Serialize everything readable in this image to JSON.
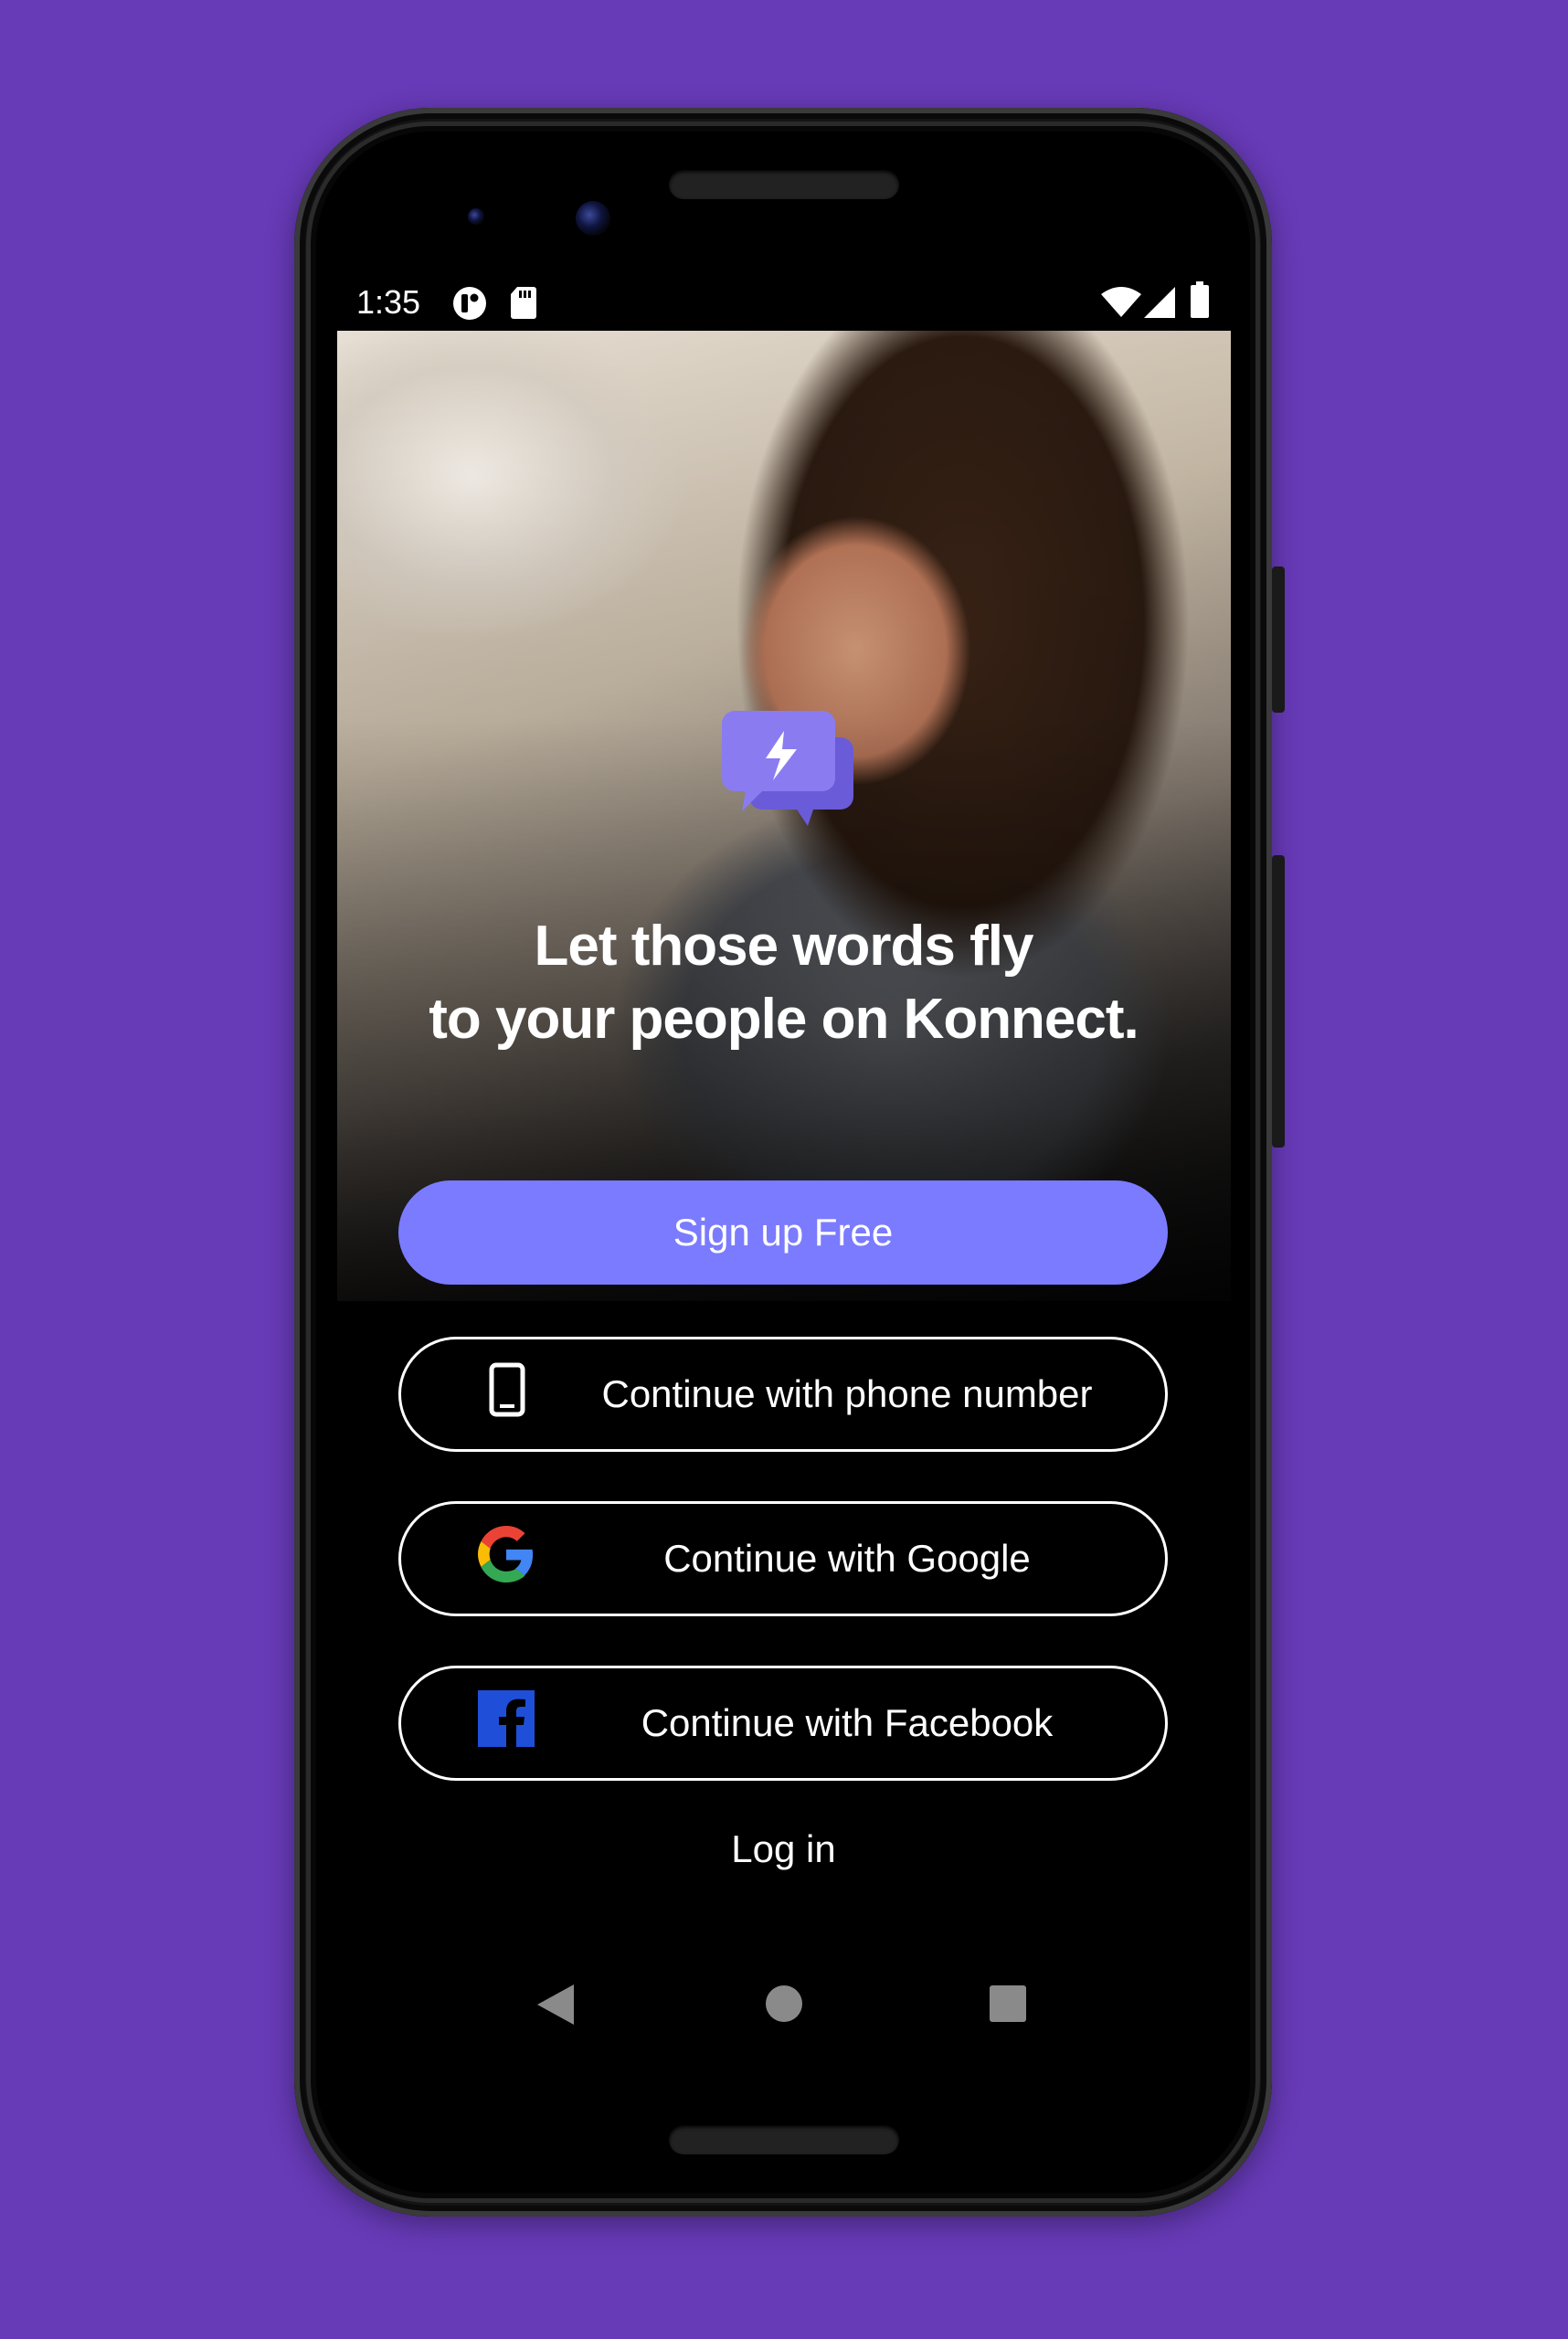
{
  "theme": {
    "background": "#673ab7",
    "accent": "#7b7bff",
    "logo_front": "#8a7cf0",
    "logo_back": "#6a5bd8",
    "facebook_blue": "#1f4fd8"
  },
  "status_bar": {
    "time": "1:35",
    "icons": [
      "app-notification-icon",
      "sd-card-icon",
      "wifi-icon",
      "cellular-signal-icon",
      "battery-icon"
    ]
  },
  "hero": {
    "logo_icon": "lightning-chat-bubble-icon",
    "headline_line1": "Let those words fly",
    "headline_line2": "to your people on Konnect."
  },
  "actions": {
    "signup_label": "Sign up Free",
    "phone_label": "Continue with phone number",
    "phone_icon": "smartphone-icon",
    "google_label": "Continue with Google",
    "google_icon": "google-g-icon",
    "facebook_label": "Continue with Facebook",
    "facebook_icon": "facebook-icon",
    "login_label": "Log in"
  },
  "nav_bar": {
    "items": [
      "back-triangle-icon",
      "home-circle-icon",
      "recents-square-icon"
    ]
  }
}
